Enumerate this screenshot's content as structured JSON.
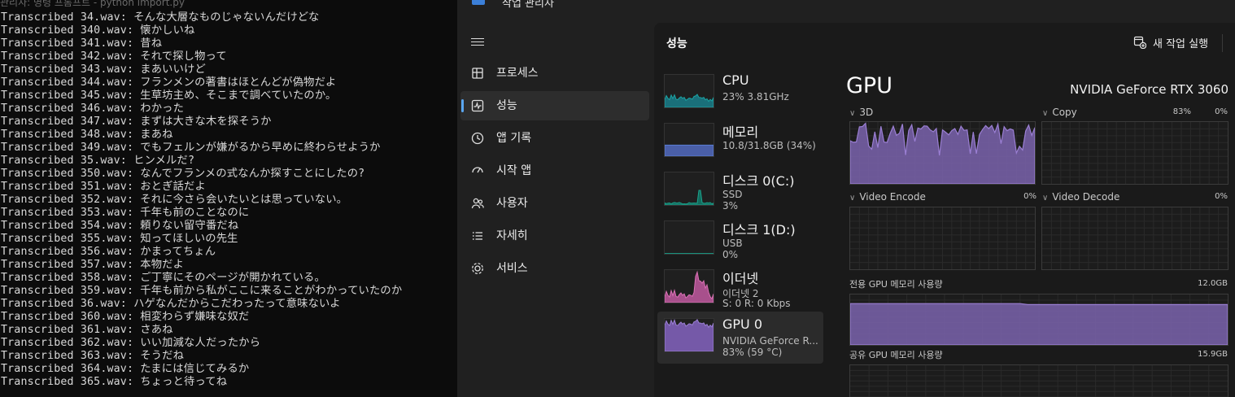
{
  "terminal": {
    "title": "관리자: 명령 프롬프트 - python import.py",
    "lines": [
      "Transcribed 34.wav: そんな大層なものじゃないんだけどな",
      "Transcribed 340.wav: 懐かしいね",
      "Transcribed 341.wav: 昔ね",
      "Transcribed 342.wav: それで探し物って",
      "Transcribed 343.wav: まあいいけど",
      "Transcribed 344.wav: フランメンの著書はほとんどが偽物だよ",
      "Transcribed 345.wav: 生草坊主め、そこまで調べていたのか。",
      "Transcribed 346.wav: わかった",
      "Transcribed 347.wav: まずは大きな木を探そうか",
      "Transcribed 348.wav: まあね",
      "Transcribed 349.wav: でもフェルンが嫌がるから早めに終わらせようか",
      "Transcribed 35.wav: ヒンメルだ?",
      "Transcribed 350.wav: なんでフランメの式なんか探すことにしたの?",
      "Transcribed 351.wav: おとぎ話だよ",
      "Transcribed 352.wav: それに今さら会いたいとは思っていない。",
      "Transcribed 353.wav: 千年も前のことなのに",
      "Transcribed 354.wav: 頼りない留守番だね",
      "Transcribed 355.wav: 知ってほしいの先生",
      "Transcribed 356.wav: かまってちょん",
      "Transcribed 357.wav: 本物だよ",
      "Transcribed 358.wav: ご丁寧にそのページが開かれている。",
      "Transcribed 359.wav: 千年も前から私がここに来ることがわかっていたのか",
      "Transcribed 36.wav: ハゲなんだからこだわったって意味ないよ",
      "Transcribed 360.wav: 相変わらず嫌味な奴だ",
      "Transcribed 361.wav: さあね",
      "Transcribed 362.wav: いい加減な人だったから",
      "Transcribed 363.wav: そうだね",
      "Transcribed 364.wav: たまには信じてみるか",
      "Transcribed 365.wav: ちょっと待ってね"
    ]
  },
  "taskmgr": {
    "title": "작업 관리자",
    "section_title": "성능",
    "new_task_label": "새 작업 실행",
    "nav": [
      {
        "label": "프로세스",
        "icon": "processes-icon"
      },
      {
        "label": "성능",
        "icon": "performance-icon",
        "active": true
      },
      {
        "label": "앱 기록",
        "icon": "app-history-icon"
      },
      {
        "label": "시작 앱",
        "icon": "startup-apps-icon"
      },
      {
        "label": "사용자",
        "icon": "users-icon"
      },
      {
        "label": "자세히",
        "icon": "details-icon"
      },
      {
        "label": "서비스",
        "icon": "services-icon"
      }
    ],
    "devices": [
      {
        "name": "CPU",
        "sub1": "23% 3.81GHz",
        "sub2": "",
        "color": "#1aa3a3"
      },
      {
        "name": "메모리",
        "sub1": "10.8/31.8GB (34%)",
        "sub2": "",
        "color": "#5b7fd6"
      },
      {
        "name": "디스크 0(C:)",
        "sub1": "SSD",
        "sub2": "3%",
        "color": "#1aa38c"
      },
      {
        "name": "디스크 1(D:)",
        "sub1": "USB",
        "sub2": "0%",
        "color": "#1aa38c"
      },
      {
        "name": "이더넷",
        "sub1": "이더넷 2",
        "sub2": "S: 0 R: 0 Kbps",
        "color": "#d970b4"
      },
      {
        "name": "GPU 0",
        "sub1": "NVIDIA GeForce R...",
        "sub2": "83% (59 °C)",
        "color": "#9b7fd4",
        "selected": true
      }
    ],
    "gpu": {
      "title": "GPU",
      "model": "NVIDIA GeForce RTX 3060",
      "engines": [
        {
          "label": "3D",
          "max": "83%"
        },
        {
          "label": "Copy",
          "max": "0%"
        },
        {
          "label": "Video Encode",
          "max": "0%"
        },
        {
          "label": "Video Decode",
          "max": "0%"
        }
      ],
      "dedicated_label": "전용 GPU 메모리 사용량",
      "dedicated_max": "12.0GB",
      "shared_label": "공유 GPU 메모리 사용량",
      "shared_max": "15.9GB",
      "dedicated_usage_fraction": 0.82,
      "color_gpu": "#9b7fd4"
    }
  }
}
